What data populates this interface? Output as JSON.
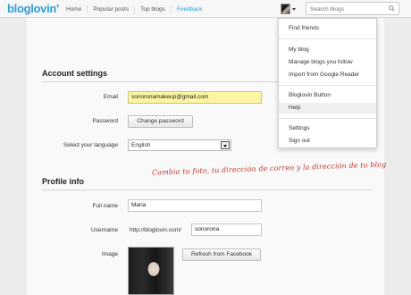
{
  "header": {
    "logo": "bloglovin'",
    "nav": [
      "Home",
      "Popular posts",
      "Top blogs",
      "Feedback"
    ],
    "search_placeholder": "Search blogs"
  },
  "dropdown": {
    "items": [
      "Find friends",
      "My blog",
      "Manage blogs you follow",
      "Import from Google Reader",
      "Bloglovin Button",
      "Help",
      "Settings",
      "Sign out"
    ]
  },
  "account": {
    "title": "Account settings",
    "email_label": "Email",
    "email_value": "sonoronamakeup@gmail.com",
    "password_label": "Password",
    "change_password": "Change password",
    "language_label": "Select your language",
    "language_value": "English"
  },
  "annotation": "Cambia tu foto, tu dirección de correo y la dirección de tu blog",
  "profile": {
    "title": "Profile info",
    "fullname_label": "Full name",
    "fullname_value": "Maria",
    "username_label": "Username",
    "username_prefix": "http://bloglovin.com/",
    "username_value": "sonorona",
    "image_label": "Image",
    "refresh_button": "Refresh from Facebook"
  },
  "colors": {
    "brand": "#2f9ed6",
    "email_highlight": "#fbf6a2",
    "annotation": "#c0392b"
  }
}
